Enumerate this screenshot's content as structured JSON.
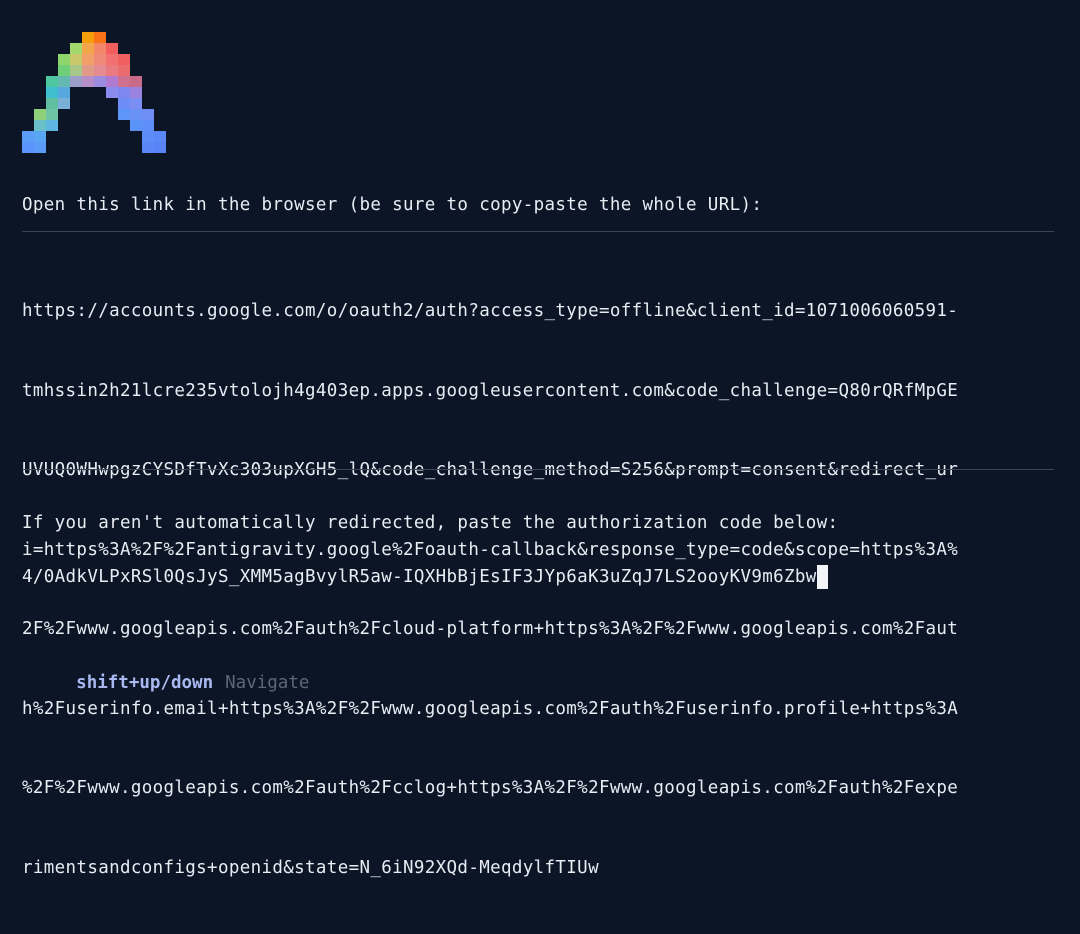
{
  "prompt": {
    "open_link_text": "Open this link in the browser (be sure to copy-paste the whole URL):"
  },
  "auth_url": {
    "lines": [
      "https://accounts.google.com/o/oauth2/auth?access_type=offline&client_id=1071006060591-",
      "tmhssin2h21lcre235vtolojh4g403ep.apps.googleusercontent.com&code_challenge=Q80rQRfMpGE",
      "UVUQ0WHwpgzCYSDfTvXc303upXGH5_lQ&code_challenge_method=S256&prompt=consent&redirect_ur",
      "i=https%3A%2F%2Fantigravity.google%2Foauth-callback&response_type=code&scope=https%3A%",
      "2F%2Fwww.googleapis.com%2Fauth%2Fcloud-platform+https%3A%2F%2Fwww.googleapis.com%2Faut",
      "h%2Fuserinfo.email+https%3A%2F%2Fwww.googleapis.com%2Fauth%2Fuserinfo.profile+https%3A",
      "%2F%2Fwww.googleapis.com%2Fauth%2Fcclog+https%3A%2F%2Fwww.googleapis.com%2Fauth%2Fexpe",
      "rimentsandconfigs+openid&state=N_6iN92XQd-MeqdylfTIUw"
    ]
  },
  "redirect": {
    "text": "If you aren't automatically redirected, paste the authorization code below:"
  },
  "auth_code_input": {
    "value": "4/0AdkVLPxRSl0QsJyS_XMM5agBvylR5aw-IQXHbBjEsIF3JYp6aK3uZqJ7LS2ooyKV9m6Zbw"
  },
  "help": {
    "key": "shift+up/down",
    "description": "Navigate"
  },
  "colors": {
    "background": "#0c1526",
    "text": "#e8ecf3",
    "divider": "#3b4556",
    "help_key": "#a8b8f0",
    "help_desc": "#5d6675"
  }
}
